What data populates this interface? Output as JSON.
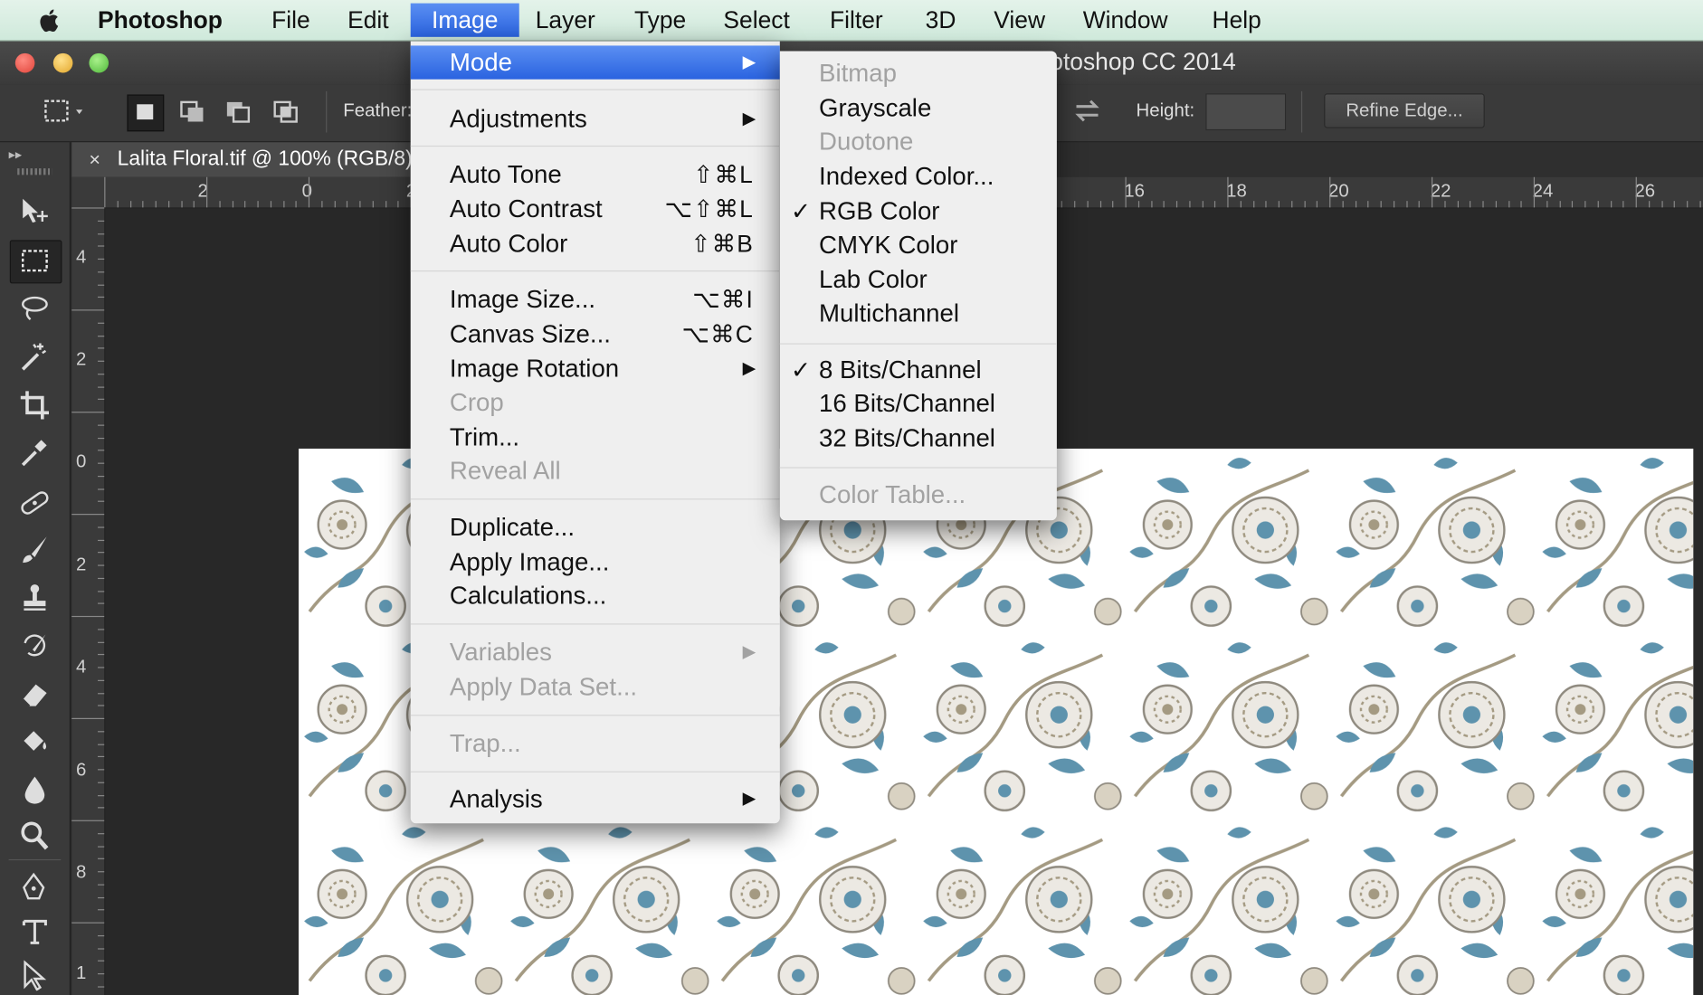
{
  "menubar": {
    "app": "Photoshop",
    "items": [
      "File",
      "Edit",
      "Image",
      "Layer",
      "Type",
      "Select",
      "Filter",
      "3D",
      "View",
      "Window",
      "Help"
    ],
    "active": "Image"
  },
  "window": {
    "title": "Adobe Photoshop CC 2014"
  },
  "options_bar": {
    "feather_label": "Feather:",
    "height_label": "Height:",
    "refine_label": "Refine Edge..."
  },
  "document": {
    "tab_title": "Lalita Floral.tif @ 100% (RGB/8)",
    "close_glyph": "×"
  },
  "ruler": {
    "h_left": [
      "2",
      "0",
      "2"
    ],
    "h_right": [
      "16",
      "18",
      "20",
      "22",
      "24",
      "26"
    ],
    "v": [
      "4",
      "2",
      "0",
      "2",
      "4",
      "6",
      "8",
      "1"
    ]
  },
  "image_menu": {
    "mode": "Mode",
    "adjustments": "Adjustments",
    "auto_tone": {
      "label": "Auto Tone",
      "shortcut": "⇧⌘L"
    },
    "auto_contrast": {
      "label": "Auto Contrast",
      "shortcut": "⌥⇧⌘L"
    },
    "auto_color": {
      "label": "Auto Color",
      "shortcut": "⇧⌘B"
    },
    "image_size": {
      "label": "Image Size...",
      "shortcut": "⌥⌘I"
    },
    "canvas_size": {
      "label": "Canvas Size...",
      "shortcut": "⌥⌘C"
    },
    "image_rotation": "Image Rotation",
    "crop": "Crop",
    "trim": "Trim...",
    "reveal_all": "Reveal All",
    "duplicate": "Duplicate...",
    "apply_image": "Apply Image...",
    "calculations": "Calculations...",
    "variables": "Variables",
    "apply_data_set": "Apply Data Set...",
    "trap": "Trap...",
    "analysis": "Analysis"
  },
  "mode_menu": {
    "bitmap": "Bitmap",
    "grayscale": "Grayscale",
    "duotone": "Duotone",
    "indexed": "Indexed Color...",
    "rgb": "RGB Color",
    "cmyk": "CMYK Color",
    "lab": "Lab Color",
    "multichannel": "Multichannel",
    "bits8": "8 Bits/Channel",
    "bits16": "16 Bits/Channel",
    "bits32": "32 Bits/Channel",
    "color_table": "Color Table...",
    "checked_mode": "RGB Color",
    "checked_depth": "8 Bits/Channel"
  },
  "glyphs": {
    "check": "✓",
    "submenu_arrow": "▶"
  },
  "colors": {
    "highlight": "#2f6be3",
    "menubar": "#d8eee1",
    "pattern_blue": "#5e93ad",
    "pattern_tan": "#a49a82"
  }
}
